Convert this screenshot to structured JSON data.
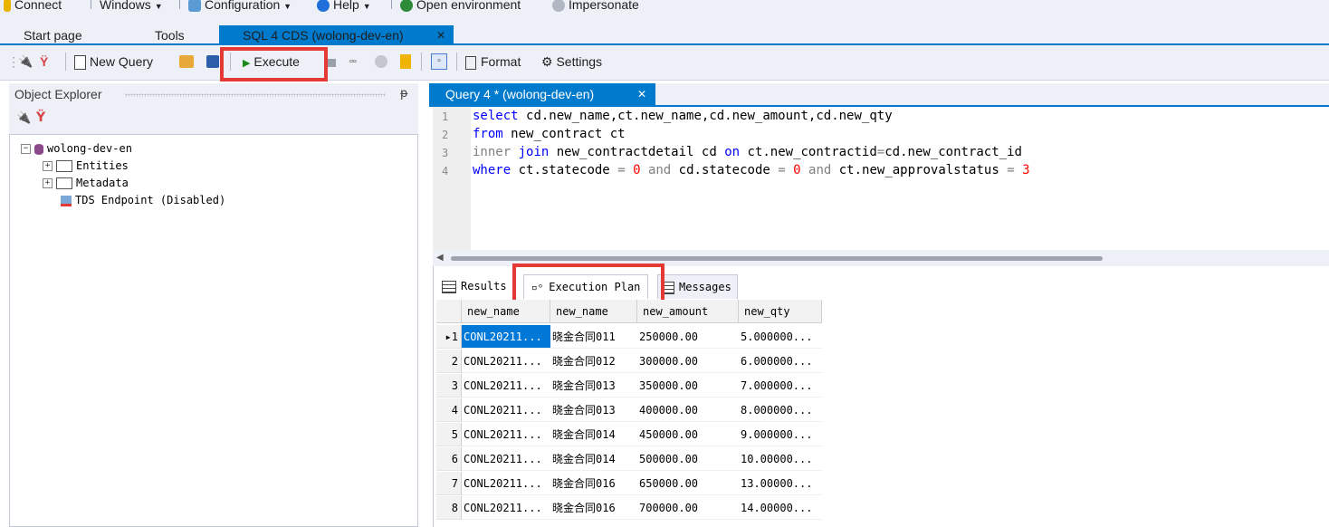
{
  "menu": {
    "items": [
      {
        "label": "Connect",
        "icon": "plug-icon",
        "has_dropdown": false
      },
      {
        "label": "Windows",
        "has_dropdown": true
      },
      {
        "label": "Configuration",
        "icon": "wrench-icon",
        "has_dropdown": true
      },
      {
        "label": "Help",
        "icon": "help-icon",
        "has_dropdown": true
      },
      {
        "label": "Open environment",
        "icon": "globe-icon",
        "has_dropdown": false
      },
      {
        "label": "Impersonate",
        "icon": "impersonate-icon",
        "has_dropdown": false
      }
    ]
  },
  "doc_tabs": {
    "start_page": "Start page",
    "tools": "Tools",
    "active": "SQL 4 CDS (wolong-dev-en)",
    "close_glyph": "✕"
  },
  "toolbar": {
    "new_query": "New Query",
    "execute": "Execute",
    "format": "Format",
    "settings": "Settings",
    "highlight_color": "#e53935"
  },
  "object_explorer": {
    "title": "Object Explorer",
    "pin_glyph": "ᵽ",
    "tree": {
      "root": "wolong-dev-en",
      "children": [
        "Entities",
        "Metadata",
        "TDS Endpoint (Disabled)"
      ]
    }
  },
  "editor": {
    "tab_label": "Query 4 * (wolong-dev-en)",
    "close_glyph": "✕",
    "line_numbers": [
      "1",
      "2",
      "3",
      "4"
    ],
    "lines": [
      "select cd.new_name,ct.new_name,cd.new_amount,cd.new_qty",
      "from new_contract ct",
      "inner join new_contractdetail cd on ct.new_contractid=cd.new_contract_id",
      "where ct.statecode = 0 and cd.statecode = 0 and ct.new_approvalstatus = 3"
    ]
  },
  "result_tabs": {
    "results": "Results",
    "execution_plan": "Execution Plan",
    "messages": "Messages"
  },
  "grid": {
    "columns": [
      "new_name",
      "new_name",
      "new_amount",
      "new_qty"
    ],
    "rows": [
      {
        "num": "1",
        "cells": [
          "CONL20211...",
          "晓金合同011",
          "250000.00",
          "5.000000..."
        ]
      },
      {
        "num": "2",
        "cells": [
          "CONL20211...",
          "晓金合同012",
          "300000.00",
          "6.000000..."
        ]
      },
      {
        "num": "3",
        "cells": [
          "CONL20211...",
          "晓金合同013",
          "350000.00",
          "7.000000..."
        ]
      },
      {
        "num": "4",
        "cells": [
          "CONL20211...",
          "晓金合同013",
          "400000.00",
          "8.000000..."
        ]
      },
      {
        "num": "5",
        "cells": [
          "CONL20211...",
          "晓金合同014",
          "450000.00",
          "9.000000..."
        ]
      },
      {
        "num": "6",
        "cells": [
          "CONL20211...",
          "晓金合同014",
          "500000.00",
          "10.00000..."
        ]
      },
      {
        "num": "7",
        "cells": [
          "CONL20211...",
          "晓金合同016",
          "650000.00",
          "13.00000..."
        ]
      },
      {
        "num": "8",
        "cells": [
          "CONL20211...",
          "晓金合同016",
          "700000.00",
          "14.00000..."
        ]
      }
    ]
  },
  "colors": {
    "accent": "#007acc",
    "highlight": "#e53935",
    "selection": "#0078d7"
  }
}
